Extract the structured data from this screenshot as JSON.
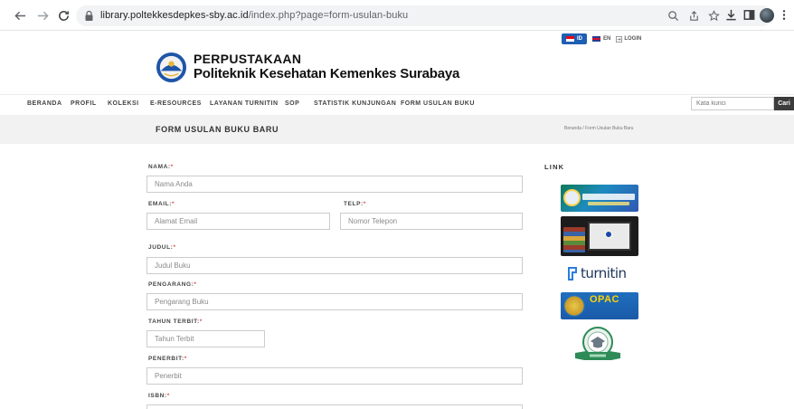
{
  "browser": {
    "url_domain": "library.poltekkesdepkes-sby.ac.id",
    "url_path": "/index.php?page=form-usulan-buku"
  },
  "topbar": {
    "lang_id": "ID",
    "lang_en": "EN",
    "login": "LOGIN"
  },
  "brand": {
    "line1": "PERPUSTAKAAN",
    "line2": "Politeknik Kesehatan Kemenkes Surabaya"
  },
  "nav": {
    "items": [
      "BERANDA",
      "PROFIL",
      "KOLEKSI",
      "E-RESOURCES",
      "LAYANAN TURNITIN",
      "SOP",
      "STATISTIK KUNJUNGAN",
      "FORM USULAN BUKU"
    ],
    "search_placeholder": "Kata kunci",
    "search_button": "Cari"
  },
  "page": {
    "title": "FORM USULAN BUKU BARU",
    "breadcrumb": "Beranda  /  Form Usulan Buku Baru"
  },
  "form": {
    "required_mark": "*",
    "nama": {
      "label": "NAMA:",
      "placeholder": "Nama Anda"
    },
    "email": {
      "label": "EMAIL:",
      "placeholder": "Alamat Email"
    },
    "telp": {
      "label": "TELP:",
      "placeholder": "Nomor Telepon"
    },
    "judul": {
      "label": "JUDUL:",
      "placeholder": "Judul Buku"
    },
    "pengarang": {
      "label": "PENGARANG:",
      "placeholder": "Pengarang Buku"
    },
    "tahun": {
      "label": "TAHUN TERBIT:",
      "placeholder": "Tahun Terbit"
    },
    "penerbit": {
      "label": "PENERBIT:",
      "placeholder": "Penerbit"
    },
    "isbn": {
      "label": "ISBN:"
    }
  },
  "sidebar": {
    "title": "LINK",
    "turnitin_text": "turnitin",
    "opac_text": "OPAC"
  }
}
